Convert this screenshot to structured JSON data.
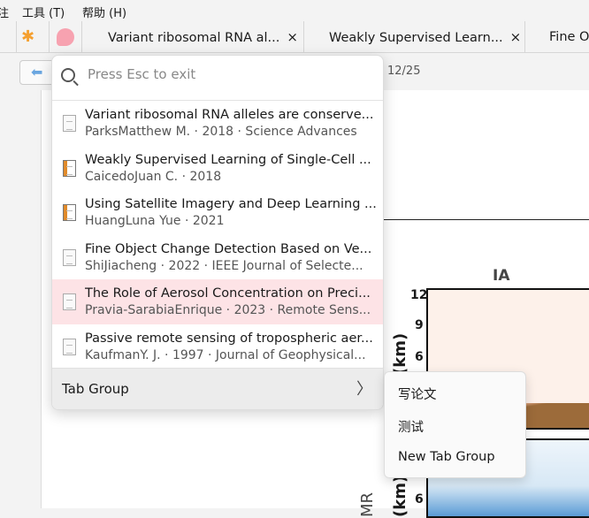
{
  "menubar": {
    "items": [
      "注",
      "工具 (T)",
      "帮助 (H)"
    ]
  },
  "tabs": [
    {
      "label": "Variant ribosomal RNA al...",
      "close": "×"
    },
    {
      "label": "Weakly Supervised Learn...",
      "close": "×"
    },
    {
      "label": "Fine O"
    }
  ],
  "toolbar": {
    "page": "12/25"
  },
  "figure": {
    "title": "IA",
    "ticks": [
      "12",
      "9",
      "6",
      "6"
    ],
    "ylabel": "(km)",
    "ylabel2": "(km)",
    "side_label": "MR"
  },
  "popup": {
    "search_placeholder": "Press Esc to exit",
    "items": [
      {
        "title": "Variant ribosomal RNA alleles are conserve...",
        "sub": "ParksMatthew M. · 2018 · Science Advances",
        "icon": "document-icon"
      },
      {
        "title": "Weakly Supervised Learning of Single-Cell ...",
        "sub": "CaicedoJuan C. · 2018",
        "icon": "book-icon"
      },
      {
        "title": "Using Satellite Imagery and Deep Learning ...",
        "sub": "HuangLuna Yue · 2021",
        "icon": "book-icon"
      },
      {
        "title": "Fine Object Change Detection Based on Ve...",
        "sub": "ShiJiacheng · 2022 · IEEE Journal of Selecte...",
        "icon": "document-icon"
      },
      {
        "title": "The Role of Aerosol Concentration on Preci...",
        "sub": "Pravia-SarabiaEnrique · 2023 · Remote Sens...",
        "icon": "document-icon",
        "selected": true
      },
      {
        "title": "Passive remote sensing of tropospheric aer...",
        "sub": "KaufmanY. J. · 1997 · Journal of Geophysical...",
        "icon": "document-icon"
      }
    ],
    "tab_group": "Tab Group"
  },
  "submenu": [
    "写论文",
    "测试",
    "New Tab Group"
  ]
}
